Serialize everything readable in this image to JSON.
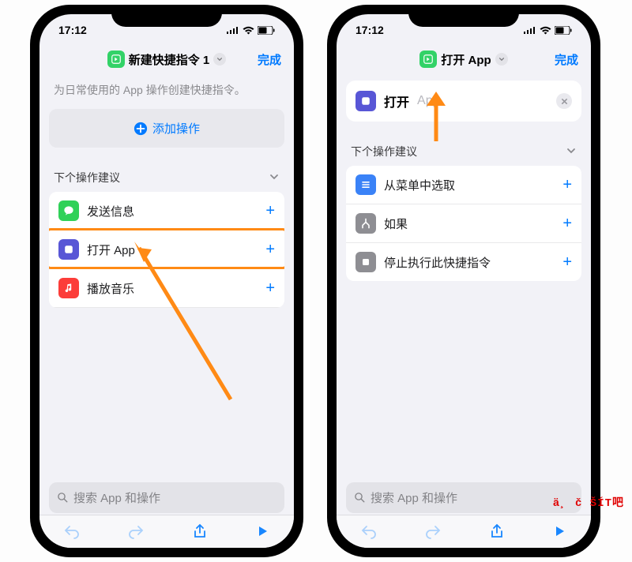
{
  "status": {
    "time": "17:12",
    "signal": "▪▪▪▪",
    "wifi": "wifi",
    "battery": "bat"
  },
  "left": {
    "title": "新建快捷指令 1",
    "done": "完成",
    "helper": "为日常使用的 App 操作创建快捷指令。",
    "addAction": "添加操作",
    "sectionTitle": "下个操作建议",
    "items": [
      "发送信息",
      "打开 App",
      "播放音乐"
    ]
  },
  "right": {
    "title": "打开 App",
    "done": "完成",
    "openLabel": "打开",
    "openAppText": "App",
    "sectionTitle": "下个操作建议",
    "items": [
      "从菜单中选取",
      "如果",
      "停止执行此快捷指令"
    ]
  },
  "search": {
    "placeholder": "搜索 App 和操作"
  },
  "colors": {
    "accent": "#007aff",
    "highlight": "#ff8a15"
  },
  "corner": "ä¸ č ŠÍT吧"
}
